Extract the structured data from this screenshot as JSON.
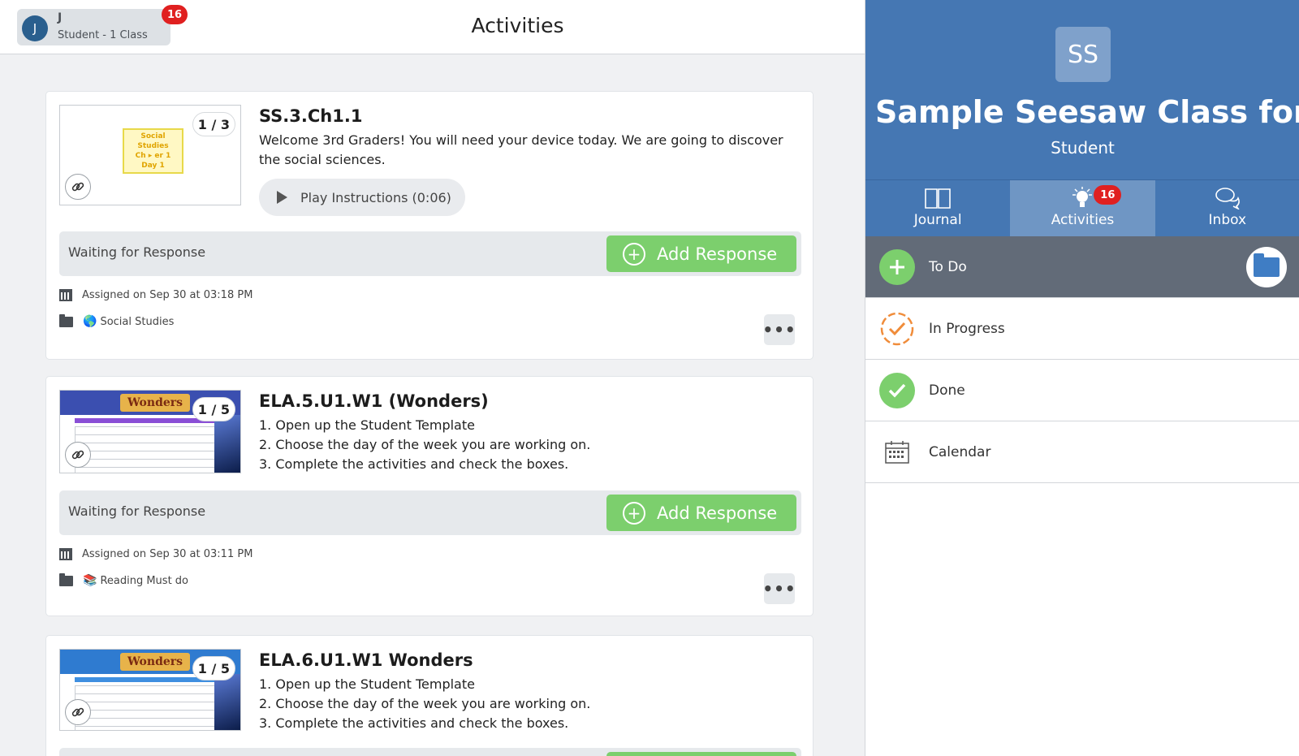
{
  "header": {
    "title": "Activities",
    "user": {
      "initial": "J",
      "name": "J",
      "role": "Student - 1 Class",
      "badge": "16"
    }
  },
  "activities": [
    {
      "title": "SS.3.Ch1.1",
      "body": "Welcome 3rd Graders!  You will need your device today.  We are going to discover the social sciences.",
      "page_count": "1 / 3",
      "thumb_lines": [
        "Social",
        "Studies",
        "Ch ▸ er 1",
        "Day 1"
      ],
      "play_label": "Play Instructions (0:06)",
      "status": "Waiting for Response",
      "add_label": "Add Response",
      "assigned": "Assigned on Sep 30 at 03:18 PM",
      "folder_emoji": "🌎",
      "folder": "Social Studies"
    },
    {
      "title": "ELA.5.U1.W1 (Wonders)",
      "body_lines": [
        "1. Open up the Student Template",
        "2. Choose the day of the week you are working on.",
        "3. Complete the activities and check the boxes."
      ],
      "page_count": "1 / 5",
      "thumb_logo": "Wonders",
      "status": "Waiting for Response",
      "add_label": "Add Response",
      "assigned": "Assigned on Sep 30 at 03:11 PM",
      "folder_emoji": "📚",
      "folder": "Reading Must do"
    },
    {
      "title": "ELA.6.U1.W1 Wonders",
      "body_lines": [
        "1. Open up the Student Template",
        "2. Choose the day of the week you are working on.",
        "3. Complete the activities and check the boxes."
      ],
      "page_count": "1 / 5",
      "thumb_logo": "Wonders"
    }
  ],
  "panel": {
    "class_initials": "SS",
    "class_name": "Sample Seesaw Class for ...",
    "role": "Student",
    "nav": [
      {
        "label": "Journal",
        "icon": "book-icon"
      },
      {
        "label": "Activities",
        "icon": "lightbulb-icon",
        "badge": "16",
        "active": true
      },
      {
        "label": "Inbox",
        "icon": "chat-bubbles-icon"
      }
    ],
    "filters": [
      {
        "label": "To Do",
        "icon": "plus-icon",
        "active": true
      },
      {
        "label": "In Progress",
        "icon": "progress-check-icon"
      },
      {
        "label": "Done",
        "icon": "check-icon"
      },
      {
        "label": "Calendar",
        "icon": "calendar-icon"
      }
    ]
  },
  "colors": {
    "green": "#7ccf6d",
    "blue": "#4577b3",
    "badge_red": "#e02020",
    "orange": "#f08c3a"
  }
}
